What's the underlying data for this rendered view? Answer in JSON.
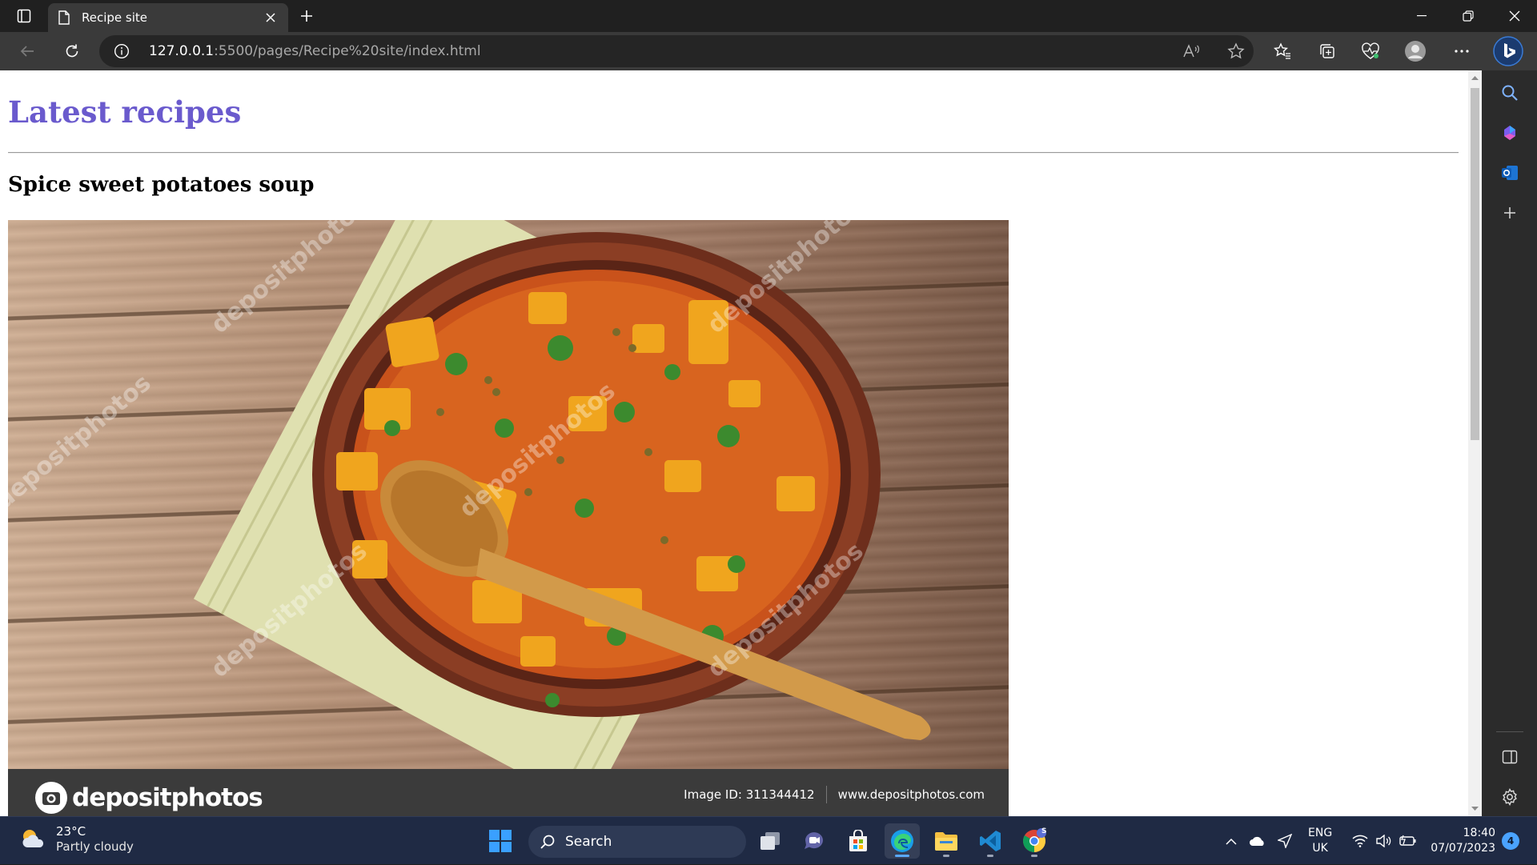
{
  "browser": {
    "tab": {
      "title": "Recipe site"
    },
    "url": {
      "host": "127.0.0.1",
      "rest": ":5500/pages/Recipe%20site/index.html"
    }
  },
  "page": {
    "heading": "Latest recipes",
    "recipe_title": "Spice sweet potatoes soup",
    "image": {
      "watermark": "depositphotos",
      "brand": "depositphotos",
      "image_id": "Image ID: 311344412",
      "site": "www.depositphotos.com"
    }
  },
  "taskbar": {
    "weather": {
      "temp": "23°C",
      "condition": "Partly cloudy"
    },
    "search_label": "Search",
    "lang_line1": "ENG",
    "lang_line2": "UK",
    "time": "18:40",
    "date": "07/07/2023",
    "notification_count": "4",
    "chrome_badge": "S"
  },
  "colors": {
    "heading": "#6a5acd",
    "taskbar": "#1f2a44",
    "accent": "#5aa9ff"
  }
}
